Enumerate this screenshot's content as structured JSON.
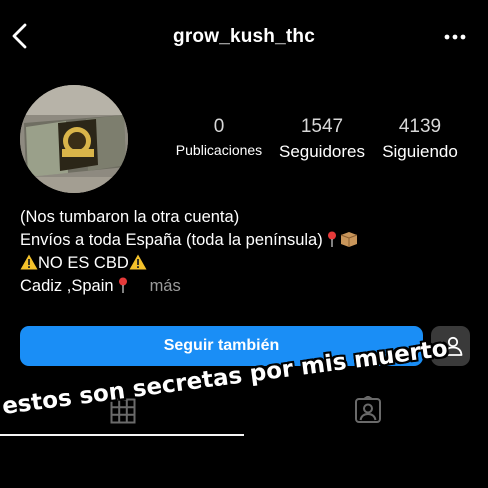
{
  "header": {
    "username": "grow_kush_thc",
    "back_icon": "chevron-left-icon",
    "more_icon": "more-horizontal-icon"
  },
  "profile": {
    "stats": {
      "posts": {
        "value": "0",
        "label": "Publicaciones"
      },
      "followers": {
        "value": "1547",
        "label": "Seguidores"
      },
      "following": {
        "value": "4139",
        "label": "Siguiendo"
      }
    },
    "bio": {
      "line1": "(Nos tumbaron la otra cuenta)",
      "line2": "Envíos a toda España (toda la península)",
      "line3": "NO ES CBD",
      "line4": "Cadiz ,Spain",
      "more": "más"
    }
  },
  "actions": {
    "follow_back_label": "Seguir también",
    "suggest_icon": "add-person-icon"
  },
  "tabs": {
    "grid_icon": "grid-icon",
    "tagged_icon": "tagged-person-icon"
  },
  "overlay": {
    "caption": "estos son secretas por mis muerto"
  },
  "colors": {
    "background": "#000000",
    "primary_button": "#1a8ef6",
    "secondary_button": "#3a3a3a",
    "muted_text": "#9a9a9a"
  }
}
